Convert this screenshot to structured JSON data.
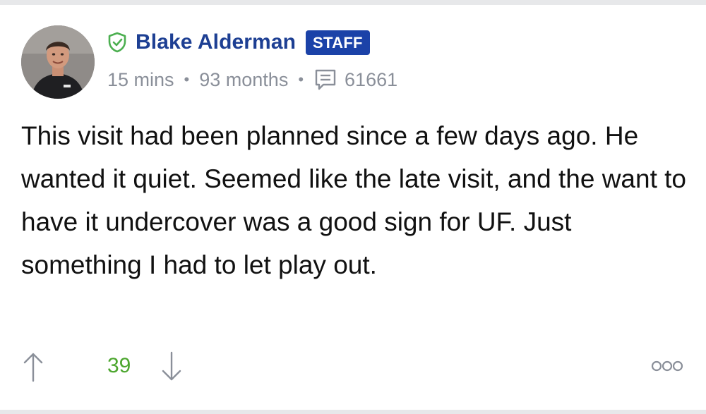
{
  "author": {
    "name": "Blake Alderman",
    "badge": "STAFF"
  },
  "meta": {
    "posted_ago": "15 mins",
    "member_for": "93 months",
    "post_count": "61661"
  },
  "post": {
    "body": "This visit had been planned since a few days ago. He wanted it quiet. Seemed like the late visit, and the want to have it undercover was a good sign for UF. Just something I had to let play out."
  },
  "votes": {
    "score": "39"
  },
  "icons": {
    "verified": "shield-check-icon",
    "comments": "comment-icon",
    "upvote": "arrow-up-icon",
    "downvote": "arrow-down-icon",
    "more": "more-icon"
  },
  "colors": {
    "author_name": "#1d3f93",
    "badge_bg": "#1b42a8",
    "verified_green": "#4caf50",
    "meta_gray": "#8a8f99",
    "score_green": "#4ca62e"
  }
}
